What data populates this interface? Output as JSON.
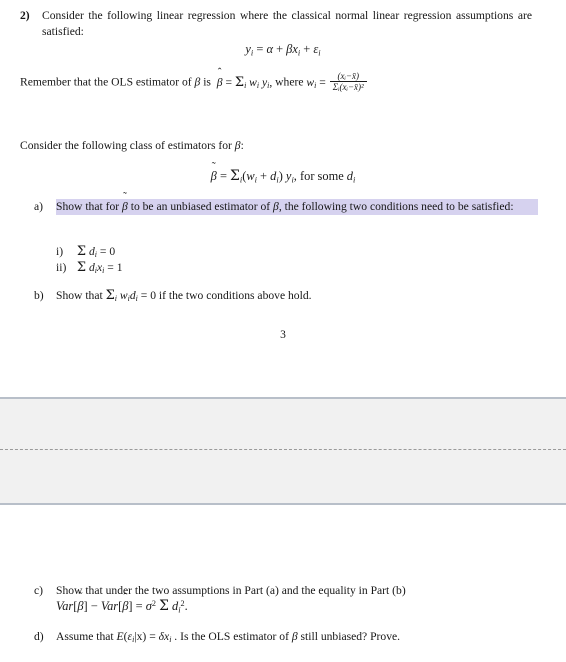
{
  "document": {
    "page_number": "3",
    "highlight_color": "#d6d2ef",
    "band_color": "#f1f1f1"
  },
  "question": {
    "marker": "2)",
    "stem": "Consider the following linear regression where the classical normal linear regression assumptions are satisfied:",
    "equation_model": "yᵢ = α + βxᵢ + εᵢ",
    "remember_prefix": "Remember that the OLS estimator of",
    "remember_mid": "is",
    "remember_where": ", where",
    "ols_beta_hat": "β̂ = Σᵢ wᵢ yᵢ",
    "weight_numerator": "(xᵢ−x̄)",
    "weight_denominator": "Σᵢ(xᵢ−x̄)²",
    "class_intro": "Consider the following class of estimators for",
    "class_intro_colon": ":",
    "beta_tilde_equation": "β̃ = Σᵢ(wᵢ + dᵢ) yᵢ, for some dᵢ"
  },
  "parts": {
    "a": {
      "marker": "a)",
      "text_1": "Show that for",
      "text_2": "to be an unbiased estimator of",
      "text_3": ", the following two conditions need to be satisfied:",
      "highlighted": true,
      "conditions": [
        {
          "label": "i)",
          "formula": "Σ dᵢ = 0"
        },
        {
          "label": "ii)",
          "formula": "Σ dᵢxᵢ = 1"
        }
      ]
    },
    "b": {
      "marker": "b)",
      "text_1": "Show that",
      "formula": "Σᵢ wᵢdᵢ = 0",
      "text_2": "if the two conditions above hold."
    },
    "c": {
      "marker": "c)",
      "text": "Show that under the two assumptions in Part (a) and the equality in Part (b)",
      "formula": "Var[β̃] − Var[β̂] = σ² Σ dᵢ²."
    },
    "d": {
      "marker": "d)",
      "text_1": "Assume that",
      "formula": "E(εᵢ|x) = δxᵢ",
      "text_2": ". Is the OLS estimator of",
      "text_3": "still unbiased? Prove."
    }
  },
  "symbols": {
    "beta": "β",
    "beta_hat": "β̂",
    "beta_tilde": "β̃"
  }
}
